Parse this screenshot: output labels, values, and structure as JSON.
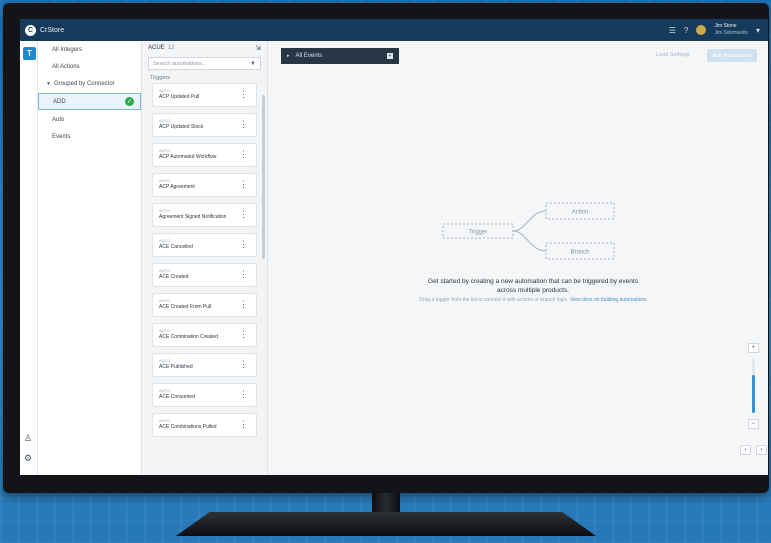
{
  "app": {
    "name": "CrStore",
    "user": {
      "name": "Jim Stone",
      "org": "Jim Sdomwelts"
    },
    "brand_color": "#1c8ad0",
    "topbar_color": "#163a5c"
  },
  "leftnav": {
    "items": [
      {
        "label": "All Integers"
      },
      {
        "label": "All Actions"
      },
      {
        "label": "Grouped by Connector"
      },
      {
        "label": "ADD"
      },
      {
        "label": "Auto"
      },
      {
        "label": "Events"
      }
    ]
  },
  "midcol": {
    "title": "ACUE",
    "count": "12",
    "search_placeholder": "Search automations...",
    "section_label": "Triggers",
    "cards": [
      {
        "pre": "AUTO",
        "name": "ACP Updated Pull"
      },
      {
        "pre": "AUTO",
        "name": "ACP Updated Stock"
      },
      {
        "pre": "AUTO",
        "name": "ACP Automated Workflow"
      },
      {
        "pre": "AUTO",
        "name": "ACP Agreement"
      },
      {
        "pre": "AUTO",
        "name": "Agreement Signed Notification"
      },
      {
        "pre": "AUTO",
        "name": "ACE Cancelled"
      },
      {
        "pre": "AUTO",
        "name": "ACE Created"
      },
      {
        "pre": "AUTO",
        "name": "ACE Created From Pull"
      },
      {
        "pre": "AUTO",
        "name": "ACE Combination Created"
      },
      {
        "pre": "AUTO",
        "name": "ACE Published"
      },
      {
        "pre": "AUTO",
        "name": "ACE Consumed"
      },
      {
        "pre": "AUTO",
        "name": "ACE Combinations Pulled"
      }
    ]
  },
  "main": {
    "dropdown_label": "All Events",
    "import_link": "Load Settings",
    "add_button": "Add Automation",
    "flow": {
      "trigger": "Trigger",
      "action": "Action",
      "branch": "Branch"
    },
    "empty_title": "Get started by creating a new automation that can be triggered by events across multiple products.",
    "empty_sub": "Drag a trigger from the list to connect it with actions or branch logic.",
    "empty_link": "View docs on building automations",
    "zoom": {
      "plus": "+",
      "minus": "−",
      "level": 0.7
    }
  }
}
